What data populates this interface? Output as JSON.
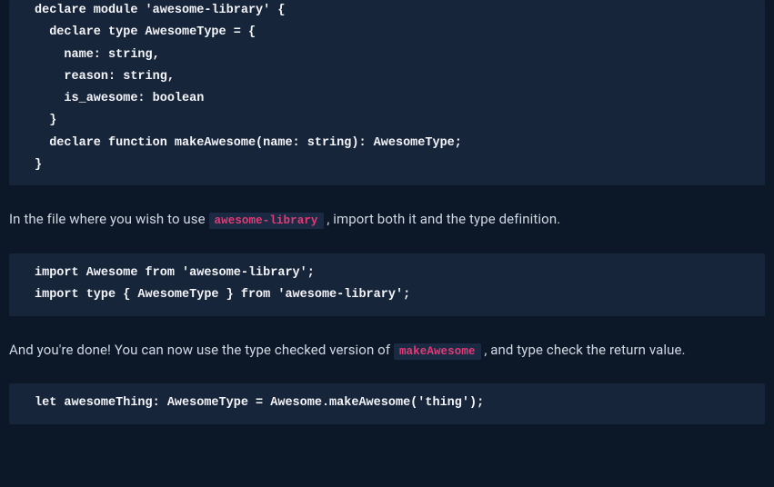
{
  "code1": "declare module 'awesome-library' {\n  declare type AwesomeType = {\n    name: string,\n    reason: string,\n    is_awesome: boolean\n  }\n  declare function makeAwesome(name: string): AwesomeType;\n}",
  "para1_pre": "In the file where you wish to use ",
  "para1_code": "awesome-library",
  "para1_post": " , import both it and the type definition.",
  "code2": "import Awesome from 'awesome-library';\nimport type { AwesomeType } from 'awesome-library';",
  "para2_pre": "And you're done! You can now use the type checked version of ",
  "para2_code": "makeAwesome",
  "para2_post": " , and type check the return value.",
  "code3": "let awesomeThing: AwesomeType = Awesome.makeAwesome('thing');"
}
